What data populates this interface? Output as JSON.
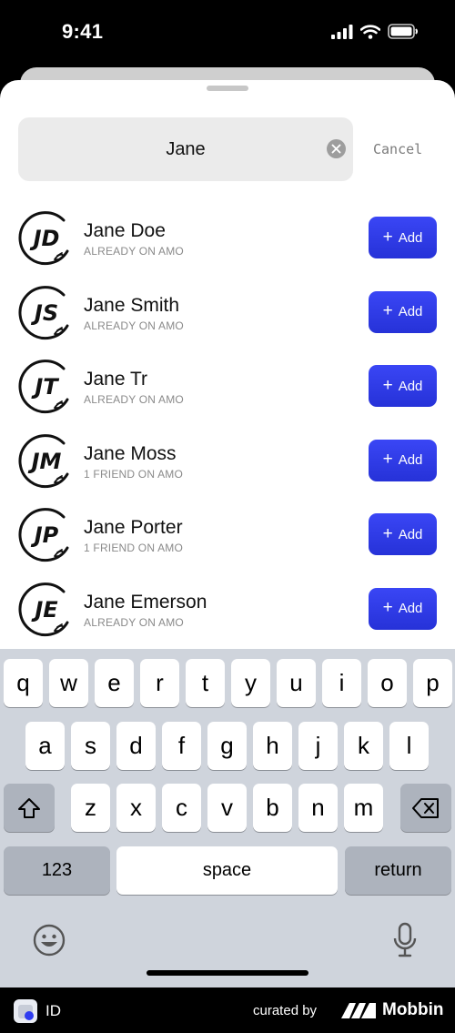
{
  "status_bar": {
    "time": "9:41"
  },
  "search": {
    "value": "Jane",
    "cancel_label": "Cancel"
  },
  "users": [
    {
      "initials": "JD",
      "name": "Jane Doe",
      "status": "ALREADY ON AMO",
      "add_label": "Add"
    },
    {
      "initials": "JS",
      "name": "Jane Smith",
      "status": "ALREADY ON AMO",
      "add_label": "Add"
    },
    {
      "initials": "JT",
      "name": "Jane Tr",
      "status": "ALREADY ON AMO",
      "add_label": "Add"
    },
    {
      "initials": "JM",
      "name": "Jane Moss",
      "status": "1 FRIEND ON AMO",
      "add_label": "Add"
    },
    {
      "initials": "JP",
      "name": "Jane Porter",
      "status": "1 FRIEND ON AMO",
      "add_label": "Add"
    },
    {
      "initials": "JE",
      "name": "Jane Emerson",
      "status": "ALREADY ON AMO",
      "add_label": "Add"
    }
  ],
  "keyboard": {
    "row1": [
      "q",
      "w",
      "e",
      "r",
      "t",
      "y",
      "u",
      "i",
      "o",
      "p"
    ],
    "row2": [
      "a",
      "s",
      "d",
      "f",
      "g",
      "h",
      "j",
      "k",
      "l"
    ],
    "row3": [
      "z",
      "x",
      "c",
      "v",
      "b",
      "n",
      "m"
    ],
    "numbers_label": "123",
    "space_label": "space",
    "return_label": "return"
  },
  "footer": {
    "app_label": "ID",
    "curated_label": "curated by",
    "brand": "Mobbin"
  },
  "colors": {
    "accent": "#2f3cf0",
    "keyboard_bg": "#cfd4dc"
  }
}
